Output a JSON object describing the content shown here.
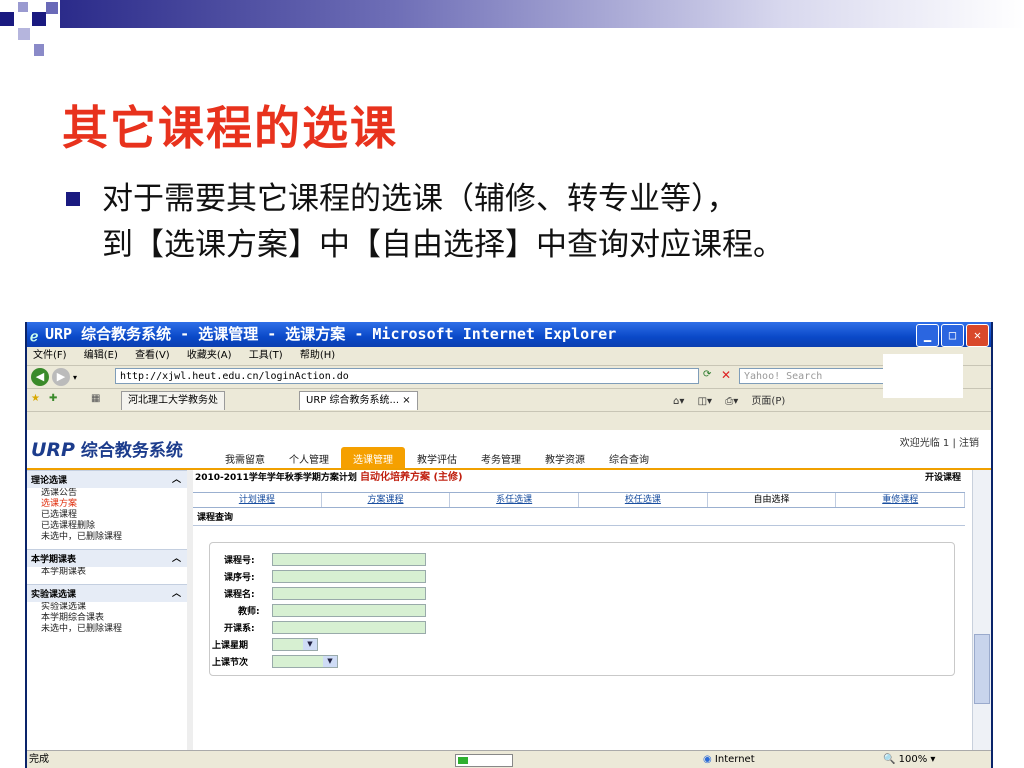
{
  "slide": {
    "title": "其它课程的选课",
    "bullet_line1": "对于需要其它课程的选课（辅修、转专业等），",
    "bullet_line2": "到【选课方案】中【自由选择】中查询对应课程。"
  },
  "browser": {
    "window_title": "URP 综合教务系统 - 选课管理 - 选课方案 - Microsoft Internet Explorer",
    "menu": [
      "文件(F)",
      "编辑(E)",
      "查看(V)",
      "收藏夹(A)",
      "工具(T)",
      "帮助(H)"
    ],
    "address": "http://xjwl.heut.edu.cn/loginAction.do",
    "search_placeholder": "Yahoo! Search",
    "tabs": [
      "河北理工大学教务处",
      "URP 综合教务系统... ×"
    ],
    "page_menu": "页面(P)",
    "status_done": "完成",
    "status_zone": "Internet",
    "status_zoom": "100%"
  },
  "app": {
    "logo_en": "URP",
    "logo_cn": "综合教务系统",
    "welcome": "欢迎光临 1 | 注销",
    "nav": [
      "我需留意",
      "个人管理",
      "选课管理",
      "教学评估",
      "考务管理",
      "教学资源",
      "综合查询"
    ],
    "sidebar": [
      {
        "title": "理论选课",
        "items": [
          "选课公告",
          "选课方案",
          "已选课程",
          "已选课程删除",
          "未选中，已删除课程"
        ]
      },
      {
        "title": "本学期课表",
        "items": [
          "本学期课表"
        ]
      },
      {
        "title": "实验课选课",
        "items": [
          "实验课选课",
          "本学期综合课表",
          "未选中，已删除课程"
        ]
      }
    ],
    "plan_prefix": "2010-2011学年学年秋季学期方案计划",
    "plan_highlight": "自动化培养方案 (主修)",
    "kaishe": "开设课程",
    "subtabs": [
      "计划课程",
      "方案课程",
      "系任选课",
      "校任选课",
      "自由选择",
      "重修课程"
    ],
    "section_title": "课程查询",
    "form_labels": [
      "课程号:",
      "课序号:",
      "课程名:",
      "教师:",
      "开课系:",
      "上课星期",
      "上课节次"
    ]
  }
}
